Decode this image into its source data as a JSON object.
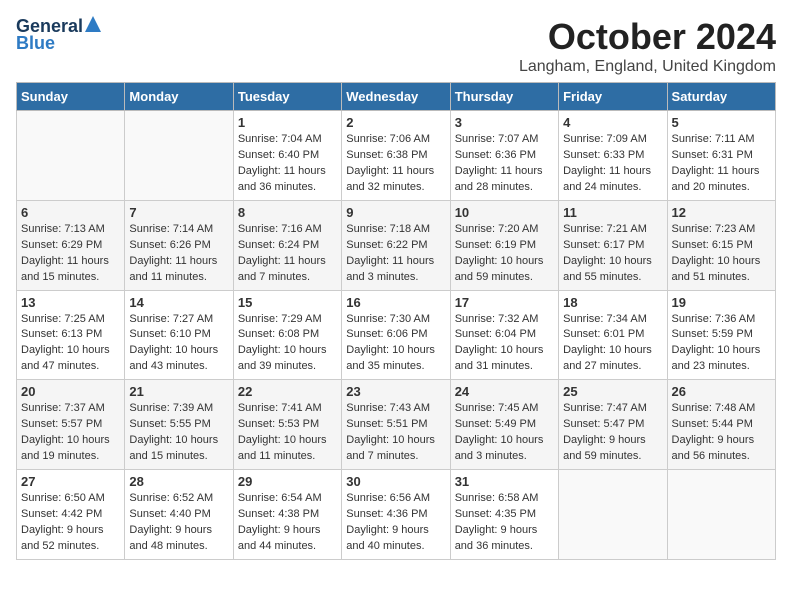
{
  "header": {
    "logo_general": "General",
    "logo_blue": "Blue",
    "month": "October 2024",
    "location": "Langham, England, United Kingdom"
  },
  "weekdays": [
    "Sunday",
    "Monday",
    "Tuesday",
    "Wednesday",
    "Thursday",
    "Friday",
    "Saturday"
  ],
  "weeks": [
    [
      {
        "day": "",
        "sunrise": "",
        "sunset": "",
        "daylight": ""
      },
      {
        "day": "",
        "sunrise": "",
        "sunset": "",
        "daylight": ""
      },
      {
        "day": "1",
        "sunrise": "Sunrise: 7:04 AM",
        "sunset": "Sunset: 6:40 PM",
        "daylight": "Daylight: 11 hours and 36 minutes."
      },
      {
        "day": "2",
        "sunrise": "Sunrise: 7:06 AM",
        "sunset": "Sunset: 6:38 PM",
        "daylight": "Daylight: 11 hours and 32 minutes."
      },
      {
        "day": "3",
        "sunrise": "Sunrise: 7:07 AM",
        "sunset": "Sunset: 6:36 PM",
        "daylight": "Daylight: 11 hours and 28 minutes."
      },
      {
        "day": "4",
        "sunrise": "Sunrise: 7:09 AM",
        "sunset": "Sunset: 6:33 PM",
        "daylight": "Daylight: 11 hours and 24 minutes."
      },
      {
        "day": "5",
        "sunrise": "Sunrise: 7:11 AM",
        "sunset": "Sunset: 6:31 PM",
        "daylight": "Daylight: 11 hours and 20 minutes."
      }
    ],
    [
      {
        "day": "6",
        "sunrise": "Sunrise: 7:13 AM",
        "sunset": "Sunset: 6:29 PM",
        "daylight": "Daylight: 11 hours and 15 minutes."
      },
      {
        "day": "7",
        "sunrise": "Sunrise: 7:14 AM",
        "sunset": "Sunset: 6:26 PM",
        "daylight": "Daylight: 11 hours and 11 minutes."
      },
      {
        "day": "8",
        "sunrise": "Sunrise: 7:16 AM",
        "sunset": "Sunset: 6:24 PM",
        "daylight": "Daylight: 11 hours and 7 minutes."
      },
      {
        "day": "9",
        "sunrise": "Sunrise: 7:18 AM",
        "sunset": "Sunset: 6:22 PM",
        "daylight": "Daylight: 11 hours and 3 minutes."
      },
      {
        "day": "10",
        "sunrise": "Sunrise: 7:20 AM",
        "sunset": "Sunset: 6:19 PM",
        "daylight": "Daylight: 10 hours and 59 minutes."
      },
      {
        "day": "11",
        "sunrise": "Sunrise: 7:21 AM",
        "sunset": "Sunset: 6:17 PM",
        "daylight": "Daylight: 10 hours and 55 minutes."
      },
      {
        "day": "12",
        "sunrise": "Sunrise: 7:23 AM",
        "sunset": "Sunset: 6:15 PM",
        "daylight": "Daylight: 10 hours and 51 minutes."
      }
    ],
    [
      {
        "day": "13",
        "sunrise": "Sunrise: 7:25 AM",
        "sunset": "Sunset: 6:13 PM",
        "daylight": "Daylight: 10 hours and 47 minutes."
      },
      {
        "day": "14",
        "sunrise": "Sunrise: 7:27 AM",
        "sunset": "Sunset: 6:10 PM",
        "daylight": "Daylight: 10 hours and 43 minutes."
      },
      {
        "day": "15",
        "sunrise": "Sunrise: 7:29 AM",
        "sunset": "Sunset: 6:08 PM",
        "daylight": "Daylight: 10 hours and 39 minutes."
      },
      {
        "day": "16",
        "sunrise": "Sunrise: 7:30 AM",
        "sunset": "Sunset: 6:06 PM",
        "daylight": "Daylight: 10 hours and 35 minutes."
      },
      {
        "day": "17",
        "sunrise": "Sunrise: 7:32 AM",
        "sunset": "Sunset: 6:04 PM",
        "daylight": "Daylight: 10 hours and 31 minutes."
      },
      {
        "day": "18",
        "sunrise": "Sunrise: 7:34 AM",
        "sunset": "Sunset: 6:01 PM",
        "daylight": "Daylight: 10 hours and 27 minutes."
      },
      {
        "day": "19",
        "sunrise": "Sunrise: 7:36 AM",
        "sunset": "Sunset: 5:59 PM",
        "daylight": "Daylight: 10 hours and 23 minutes."
      }
    ],
    [
      {
        "day": "20",
        "sunrise": "Sunrise: 7:37 AM",
        "sunset": "Sunset: 5:57 PM",
        "daylight": "Daylight: 10 hours and 19 minutes."
      },
      {
        "day": "21",
        "sunrise": "Sunrise: 7:39 AM",
        "sunset": "Sunset: 5:55 PM",
        "daylight": "Daylight: 10 hours and 15 minutes."
      },
      {
        "day": "22",
        "sunrise": "Sunrise: 7:41 AM",
        "sunset": "Sunset: 5:53 PM",
        "daylight": "Daylight: 10 hours and 11 minutes."
      },
      {
        "day": "23",
        "sunrise": "Sunrise: 7:43 AM",
        "sunset": "Sunset: 5:51 PM",
        "daylight": "Daylight: 10 hours and 7 minutes."
      },
      {
        "day": "24",
        "sunrise": "Sunrise: 7:45 AM",
        "sunset": "Sunset: 5:49 PM",
        "daylight": "Daylight: 10 hours and 3 minutes."
      },
      {
        "day": "25",
        "sunrise": "Sunrise: 7:47 AM",
        "sunset": "Sunset: 5:47 PM",
        "daylight": "Daylight: 9 hours and 59 minutes."
      },
      {
        "day": "26",
        "sunrise": "Sunrise: 7:48 AM",
        "sunset": "Sunset: 5:44 PM",
        "daylight": "Daylight: 9 hours and 56 minutes."
      }
    ],
    [
      {
        "day": "27",
        "sunrise": "Sunrise: 6:50 AM",
        "sunset": "Sunset: 4:42 PM",
        "daylight": "Daylight: 9 hours and 52 minutes."
      },
      {
        "day": "28",
        "sunrise": "Sunrise: 6:52 AM",
        "sunset": "Sunset: 4:40 PM",
        "daylight": "Daylight: 9 hours and 48 minutes."
      },
      {
        "day": "29",
        "sunrise": "Sunrise: 6:54 AM",
        "sunset": "Sunset: 4:38 PM",
        "daylight": "Daylight: 9 hours and 44 minutes."
      },
      {
        "day": "30",
        "sunrise": "Sunrise: 6:56 AM",
        "sunset": "Sunset: 4:36 PM",
        "daylight": "Daylight: 9 hours and 40 minutes."
      },
      {
        "day": "31",
        "sunrise": "Sunrise: 6:58 AM",
        "sunset": "Sunset: 4:35 PM",
        "daylight": "Daylight: 9 hours and 36 minutes."
      },
      {
        "day": "",
        "sunrise": "",
        "sunset": "",
        "daylight": ""
      },
      {
        "day": "",
        "sunrise": "",
        "sunset": "",
        "daylight": ""
      }
    ]
  ]
}
